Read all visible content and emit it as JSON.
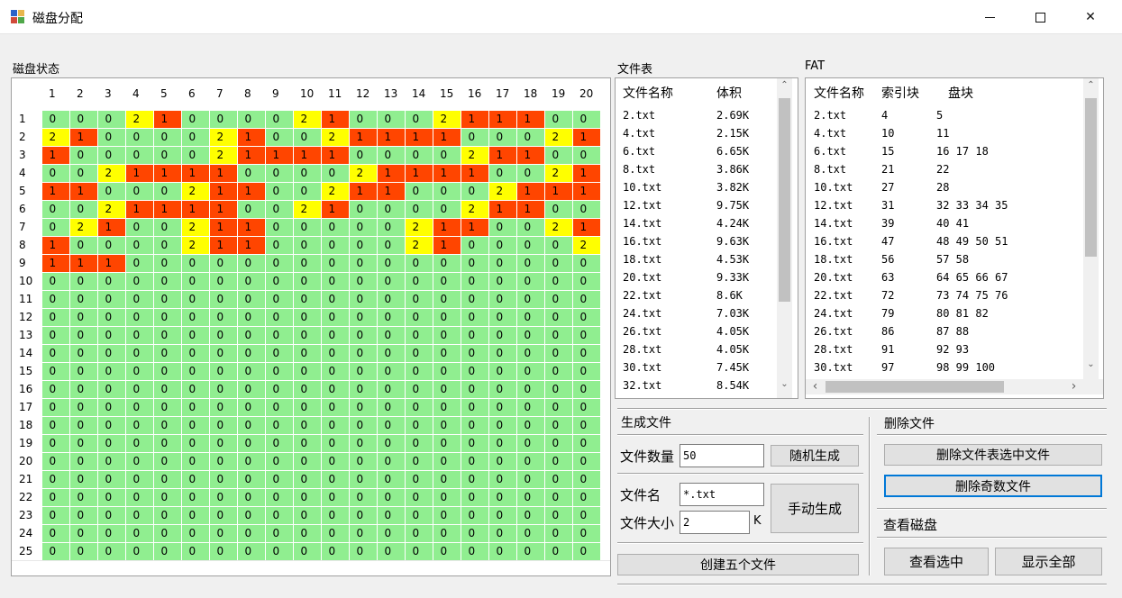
{
  "window": {
    "title": "磁盘分配",
    "minimize_glyph": "—",
    "maximize_glyph": "☐",
    "close_glyph": "✕"
  },
  "disk": {
    "label": "磁盘状态",
    "column_headers": [
      "1",
      "2",
      "3",
      "4",
      "5",
      "6",
      "7",
      "8",
      "9",
      "10",
      "11",
      "12",
      "13",
      "14",
      "15",
      "16",
      "17",
      "18",
      "19",
      "20"
    ],
    "row_headers": [
      "1",
      "2",
      "3",
      "4",
      "5",
      "6",
      "7",
      "8",
      "9",
      "10",
      "11",
      "12",
      "13",
      "14",
      "15",
      "16",
      "17",
      "18",
      "19",
      "20",
      "21",
      "22",
      "23",
      "24",
      "25"
    ],
    "rows": [
      [
        0,
        0,
        0,
        2,
        1,
        0,
        0,
        0,
        0,
        2,
        1,
        0,
        0,
        0,
        2,
        1,
        1,
        1,
        0,
        0
      ],
      [
        2,
        1,
        0,
        0,
        0,
        0,
        2,
        1,
        0,
        0,
        2,
        1,
        1,
        1,
        1,
        0,
        0,
        0,
        2,
        1
      ],
      [
        1,
        0,
        0,
        0,
        0,
        0,
        2,
        1,
        1,
        1,
        1,
        0,
        0,
        0,
        0,
        2,
        1,
        1,
        0,
        0
      ],
      [
        0,
        0,
        2,
        1,
        1,
        1,
        1,
        0,
        0,
        0,
        0,
        2,
        1,
        1,
        1,
        1,
        0,
        0,
        2,
        1
      ],
      [
        1,
        1,
        0,
        0,
        0,
        2,
        1,
        1,
        0,
        0,
        2,
        1,
        1,
        0,
        0,
        0,
        2,
        1,
        1,
        1
      ],
      [
        0,
        0,
        2,
        1,
        1,
        1,
        1,
        0,
        0,
        2,
        1,
        0,
        0,
        0,
        0,
        2,
        1,
        1,
        0,
        0
      ],
      [
        0,
        2,
        1,
        0,
        0,
        2,
        1,
        1,
        0,
        0,
        0,
        0,
        0,
        2,
        1,
        1,
        0,
        0,
        2,
        1
      ],
      [
        1,
        0,
        0,
        0,
        0,
        2,
        1,
        1,
        0,
        0,
        0,
        0,
        0,
        2,
        1,
        0,
        0,
        0,
        0,
        2
      ],
      [
        1,
        1,
        1,
        0,
        0,
        0,
        0,
        0,
        0,
        0,
        0,
        0,
        0,
        0,
        0,
        0,
        0,
        0,
        0,
        0
      ],
      [
        0,
        0,
        0,
        0,
        0,
        0,
        0,
        0,
        0,
        0,
        0,
        0,
        0,
        0,
        0,
        0,
        0,
        0,
        0,
        0
      ],
      [
        0,
        0,
        0,
        0,
        0,
        0,
        0,
        0,
        0,
        0,
        0,
        0,
        0,
        0,
        0,
        0,
        0,
        0,
        0,
        0
      ],
      [
        0,
        0,
        0,
        0,
        0,
        0,
        0,
        0,
        0,
        0,
        0,
        0,
        0,
        0,
        0,
        0,
        0,
        0,
        0,
        0
      ],
      [
        0,
        0,
        0,
        0,
        0,
        0,
        0,
        0,
        0,
        0,
        0,
        0,
        0,
        0,
        0,
        0,
        0,
        0,
        0,
        0
      ],
      [
        0,
        0,
        0,
        0,
        0,
        0,
        0,
        0,
        0,
        0,
        0,
        0,
        0,
        0,
        0,
        0,
        0,
        0,
        0,
        0
      ],
      [
        0,
        0,
        0,
        0,
        0,
        0,
        0,
        0,
        0,
        0,
        0,
        0,
        0,
        0,
        0,
        0,
        0,
        0,
        0,
        0
      ],
      [
        0,
        0,
        0,
        0,
        0,
        0,
        0,
        0,
        0,
        0,
        0,
        0,
        0,
        0,
        0,
        0,
        0,
        0,
        0,
        0
      ],
      [
        0,
        0,
        0,
        0,
        0,
        0,
        0,
        0,
        0,
        0,
        0,
        0,
        0,
        0,
        0,
        0,
        0,
        0,
        0,
        0
      ],
      [
        0,
        0,
        0,
        0,
        0,
        0,
        0,
        0,
        0,
        0,
        0,
        0,
        0,
        0,
        0,
        0,
        0,
        0,
        0,
        0
      ],
      [
        0,
        0,
        0,
        0,
        0,
        0,
        0,
        0,
        0,
        0,
        0,
        0,
        0,
        0,
        0,
        0,
        0,
        0,
        0,
        0
      ],
      [
        0,
        0,
        0,
        0,
        0,
        0,
        0,
        0,
        0,
        0,
        0,
        0,
        0,
        0,
        0,
        0,
        0,
        0,
        0,
        0
      ],
      [
        0,
        0,
        0,
        0,
        0,
        0,
        0,
        0,
        0,
        0,
        0,
        0,
        0,
        0,
        0,
        0,
        0,
        0,
        0,
        0
      ],
      [
        0,
        0,
        0,
        0,
        0,
        0,
        0,
        0,
        0,
        0,
        0,
        0,
        0,
        0,
        0,
        0,
        0,
        0,
        0,
        0
      ],
      [
        0,
        0,
        0,
        0,
        0,
        0,
        0,
        0,
        0,
        0,
        0,
        0,
        0,
        0,
        0,
        0,
        0,
        0,
        0,
        0
      ],
      [
        0,
        0,
        0,
        0,
        0,
        0,
        0,
        0,
        0,
        0,
        0,
        0,
        0,
        0,
        0,
        0,
        0,
        0,
        0,
        0
      ],
      [
        0,
        0,
        0,
        0,
        0,
        0,
        0,
        0,
        0,
        0,
        0,
        0,
        0,
        0,
        0,
        0,
        0,
        0,
        0,
        0
      ]
    ],
    "colors": {
      "free": "#90ee90",
      "index": "#ff4500",
      "data": "#ffff00"
    }
  },
  "file_table": {
    "label": "文件表",
    "headers": [
      "文件名称",
      "体积"
    ],
    "rows": [
      [
        "2.txt",
        "2.69K"
      ],
      [
        "4.txt",
        "2.15K"
      ],
      [
        "6.txt",
        "6.65K"
      ],
      [
        "8.txt",
        "3.86K"
      ],
      [
        "10.txt",
        "3.82K"
      ],
      [
        "12.txt",
        "9.75K"
      ],
      [
        "14.txt",
        "4.24K"
      ],
      [
        "16.txt",
        "9.63K"
      ],
      [
        "18.txt",
        "4.53K"
      ],
      [
        "20.txt",
        "9.33K"
      ],
      [
        "22.txt",
        "8.6K"
      ],
      [
        "24.txt",
        "7.03K"
      ],
      [
        "26.txt",
        "4.05K"
      ],
      [
        "28.txt",
        "4.05K"
      ],
      [
        "30.txt",
        "7.45K"
      ],
      [
        "32.txt",
        "8.54K"
      ]
    ],
    "scroll_up": "⌃",
    "scroll_down": "⌄"
  },
  "fat": {
    "label": "FAT",
    "headers": [
      "文件名称",
      "索引块",
      "盘块"
    ],
    "rows": [
      [
        "2.txt",
        "4",
        "5"
      ],
      [
        "4.txt",
        "10",
        "11"
      ],
      [
        "6.txt",
        "15",
        "16 17 18"
      ],
      [
        "8.txt",
        "21",
        "22"
      ],
      [
        "10.txt",
        "27",
        "28"
      ],
      [
        "12.txt",
        "31",
        "32 33 34 35"
      ],
      [
        "14.txt",
        "39",
        "40 41"
      ],
      [
        "16.txt",
        "47",
        "48 49 50 51"
      ],
      [
        "18.txt",
        "56",
        "57 58"
      ],
      [
        "20.txt",
        "63",
        "64 65 66 67"
      ],
      [
        "22.txt",
        "72",
        "73 74 75 76"
      ],
      [
        "24.txt",
        "79",
        "80 81 82"
      ],
      [
        "26.txt",
        "86",
        "87 88"
      ],
      [
        "28.txt",
        "91",
        "92 93"
      ],
      [
        "30.txt",
        "97",
        "98 99 100"
      ]
    ],
    "scroll_up": "⌃",
    "scroll_down": "⌄",
    "scroll_left": "‹",
    "scroll_right": "›"
  },
  "generate": {
    "label": "生成文件",
    "count_label": "文件数量",
    "count_value": "50",
    "random_button": "随机生成",
    "name_label": "文件名",
    "name_value": "*.txt",
    "size_label": "文件大小",
    "size_value": "2",
    "size_unit": "K",
    "manual_button": "手动生成",
    "create_five_button": "创建五个文件"
  },
  "delete": {
    "label": "删除文件",
    "delete_selected_button": "删除文件表选中文件",
    "delete_odd_button": "删除奇数文件"
  },
  "view": {
    "label": "查看磁盘",
    "view_selected_button": "查看选中",
    "show_all_button": "显示全部"
  }
}
